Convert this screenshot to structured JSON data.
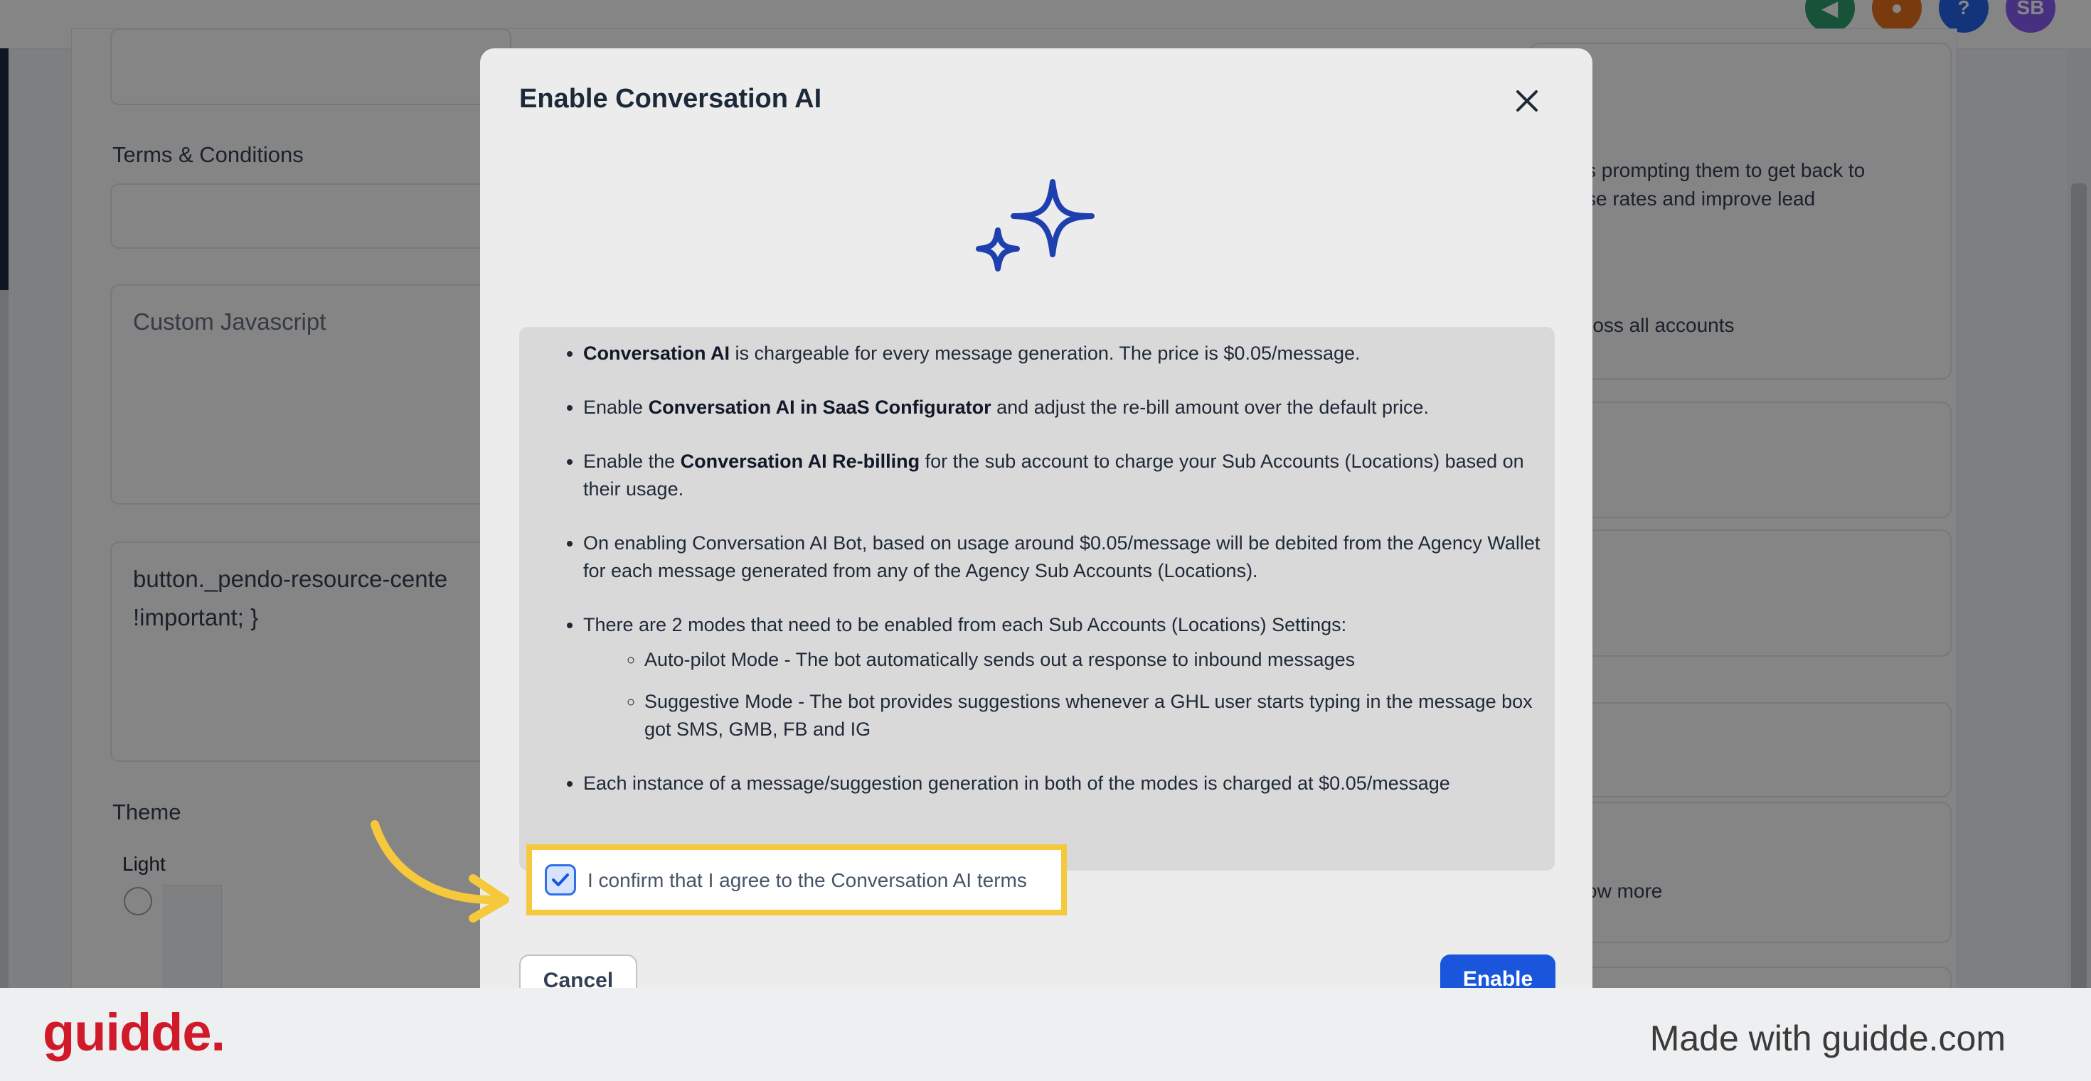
{
  "background": {
    "labels": {
      "terms": "Terms & Conditions",
      "theme": "Theme",
      "theme_light": "Light"
    },
    "textareas": {
      "custom_js_placeholder": "Custom Javascript",
      "css_line1": "button._pendo-resource-cente",
      "css_line2": "!important; }"
    },
    "right_texts": {
      "t1": "s prompting them to get back to",
      "t2": "se rates and improve lead",
      "t3": "ross all accounts",
      "t4": "ow more"
    },
    "avatar_initials": "SB"
  },
  "modal": {
    "title": "Enable Conversation AI",
    "close_icon": "close-icon",
    "sparkle_icon": "sparkle-icon",
    "terms": [
      {
        "bold": "Conversation AI",
        "pre": "",
        "post": " is chargeable for every message generation. The price is $0.05/message."
      },
      {
        "pre": "Enable ",
        "bold": "Conversation AI in SaaS Configurator",
        "post": " and adjust the re-bill amount over the default price."
      },
      {
        "pre": "Enable the ",
        "bold": "Conversation AI Re-billing",
        "post": " for the sub account to charge your Sub Accounts (Locations) based on their usage."
      },
      {
        "pre": "On enabling Conversation AI Bot, based on usage around $0.05/message will be debited from the Agency Wallet for each message generated from any of the Agency Sub Accounts (Locations).",
        "bold": "",
        "post": ""
      },
      {
        "pre": "There are 2 modes that need to be enabled from each Sub Accounts (Locations) Settings:",
        "bold": "",
        "post": ""
      },
      {
        "pre": "Each instance of a message/suggestion generation in both of the modes is charged at $0.05/message",
        "bold": "",
        "post": ""
      }
    ],
    "modes": [
      "Auto-pilot Mode - The bot automatically sends out a response to inbound messages",
      "Suggestive Mode - The bot provides suggestions whenever a GHL user starts typing in the message box got SMS, GMB, FB and IG"
    ],
    "confirm_label": "I confirm that I agree to the Conversation AI terms",
    "confirm_checked": true,
    "cancel_label": "Cancel",
    "enable_label": "Enable",
    "colors": {
      "accent": "#1a56db",
      "highlight": "#f5c93b",
      "sparkle": "#1e40af"
    }
  },
  "footer": {
    "logo": "guidde.",
    "made_with": "Made with guidde.com"
  }
}
